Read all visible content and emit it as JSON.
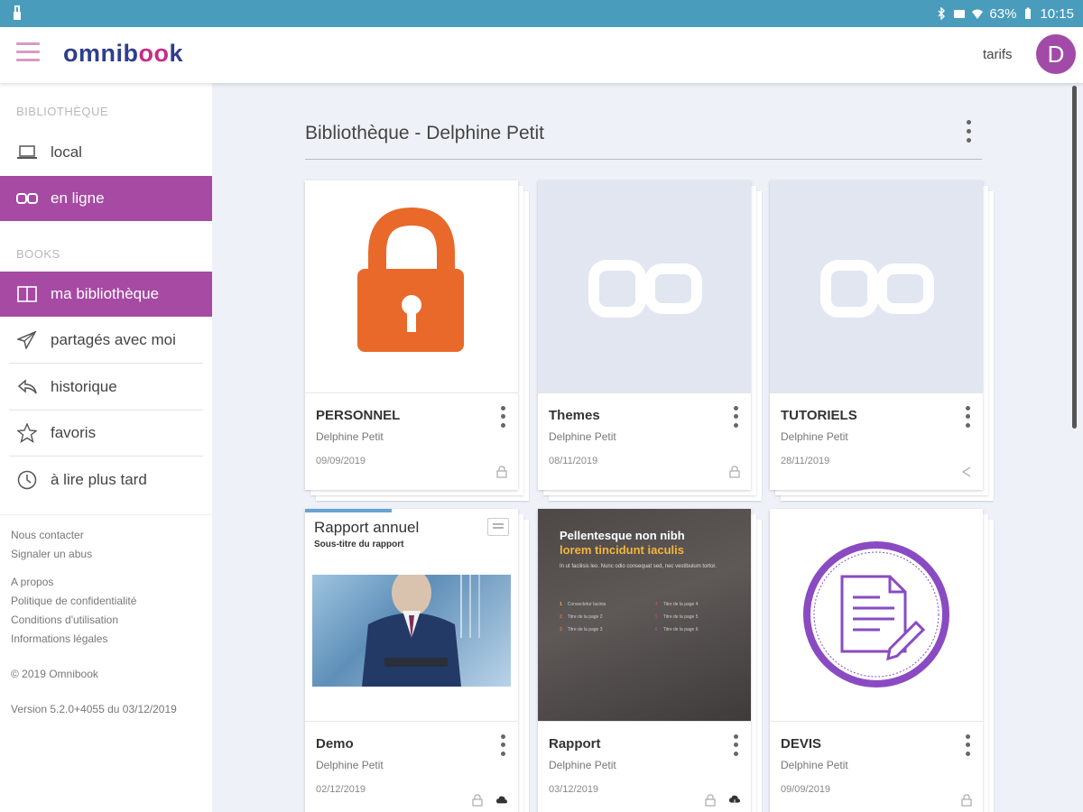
{
  "status_bar": {
    "battery": "63%",
    "time": "10:15"
  },
  "app": {
    "logo_part1": "omnib",
    "logo_part2": "oo",
    "logo_part3": "k",
    "tarifs": "tarifs",
    "avatar_letter": "D"
  },
  "sidebar": {
    "section_library": "BIBLIOTHÈQUE",
    "section_books": "BOOKS",
    "items": [
      {
        "label": "local",
        "icon": "laptop-icon"
      },
      {
        "label": "en ligne",
        "icon": "omnibook-cloud-icon"
      },
      {
        "label": "ma bibliothèque",
        "icon": "book-icon"
      },
      {
        "label": "partagés avec moi",
        "icon": "paper-plane-icon"
      },
      {
        "label": "historique",
        "icon": "reply-icon"
      },
      {
        "label": "favoris",
        "icon": "star-icon"
      },
      {
        "label": "à lire plus tard",
        "icon": "clock-icon"
      }
    ],
    "footer_links": [
      "Nous contacter",
      "Signaler un abus",
      "A propos",
      "Politique de confidentialité",
      "Conditions d'utilisation",
      "Informations légales"
    ],
    "copyright": "© 2019 Omnibook",
    "version": "Version 5.2.0+4055 du 03/12/2019"
  },
  "main": {
    "title": "Bibliothèque - Delphine Petit",
    "cards": [
      {
        "title": "PERSONNEL",
        "owner": "Delphine Petit",
        "date": "09/09/2019",
        "cover": "lock"
      },
      {
        "title": "Themes",
        "owner": "Delphine Petit",
        "date": "08/11/2019",
        "cover": "omnibook"
      },
      {
        "title": "TUTORIELS",
        "owner": "Delphine Petit",
        "date": "28/11/2019",
        "cover": "omnibook"
      },
      {
        "title": "Demo",
        "owner": "Delphine Petit",
        "date": "02/12/2019",
        "cover": "rapport-annuel"
      },
      {
        "title": "Rapport",
        "owner": "Delphine Petit",
        "date": "03/12/2019",
        "cover": "rapport"
      },
      {
        "title": "DEVIS",
        "owner": "Delphine Petit",
        "date": "09/09/2019",
        "cover": "devis"
      }
    ],
    "demo_cover": {
      "title": "Rapport annuel",
      "subtitle": "Sous-titre du rapport"
    },
    "rapport_cover": {
      "heading1": "Pellentesque non nibh",
      "heading2": "lorem tincidunt iaculis",
      "intro": "In ut facilisis leo. Nunc odio consequat sed, nec vestibulum tortor.",
      "items": [
        {
          "n": "1",
          "t": "Consectetur lacinia"
        },
        {
          "n": "2",
          "t": "Titre de la page 2"
        },
        {
          "n": "3",
          "t": "Titre de la page 3"
        },
        {
          "n": "4",
          "t": "Titre de la page 4"
        },
        {
          "n": "5",
          "t": "Titre de la page 5"
        },
        {
          "n": "6",
          "t": "Titre de la page 6"
        }
      ]
    }
  },
  "colors": {
    "accent": "#a64aa3",
    "status_bar": "#4a9cbd",
    "lock_orange": "#e8692a",
    "devis_purple": "#8a4bc2"
  }
}
